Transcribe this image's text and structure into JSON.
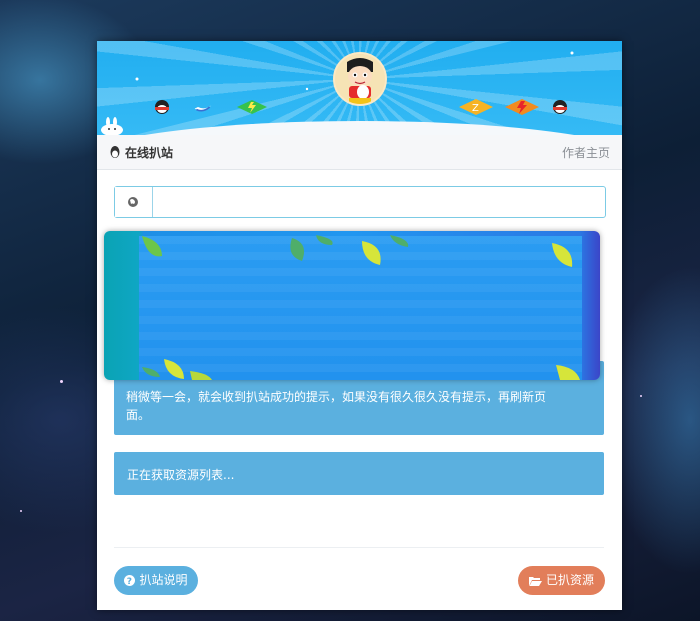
{
  "banner": {
    "avatar_alt": "cartoon boy avatar"
  },
  "panel_header": {
    "title": "在线扒站",
    "author_link": "作者主页"
  },
  "url_input": {
    "value": "",
    "placeholder": ""
  },
  "info": {
    "marker": "*",
    "text": "稍微等一会，就会收到扒站成功的提示，如果没有很久很久没有提示，再刷新页面。"
  },
  "status": {
    "text": "正在获取资源列表..."
  },
  "buttons": {
    "help_label": "扒站说明",
    "resources_label": "已扒资源"
  },
  "colors": {
    "accent": "#5bb0df",
    "warning_button": "#e27e5a",
    "banner": "#21aef0",
    "popup": "#2196f0"
  }
}
